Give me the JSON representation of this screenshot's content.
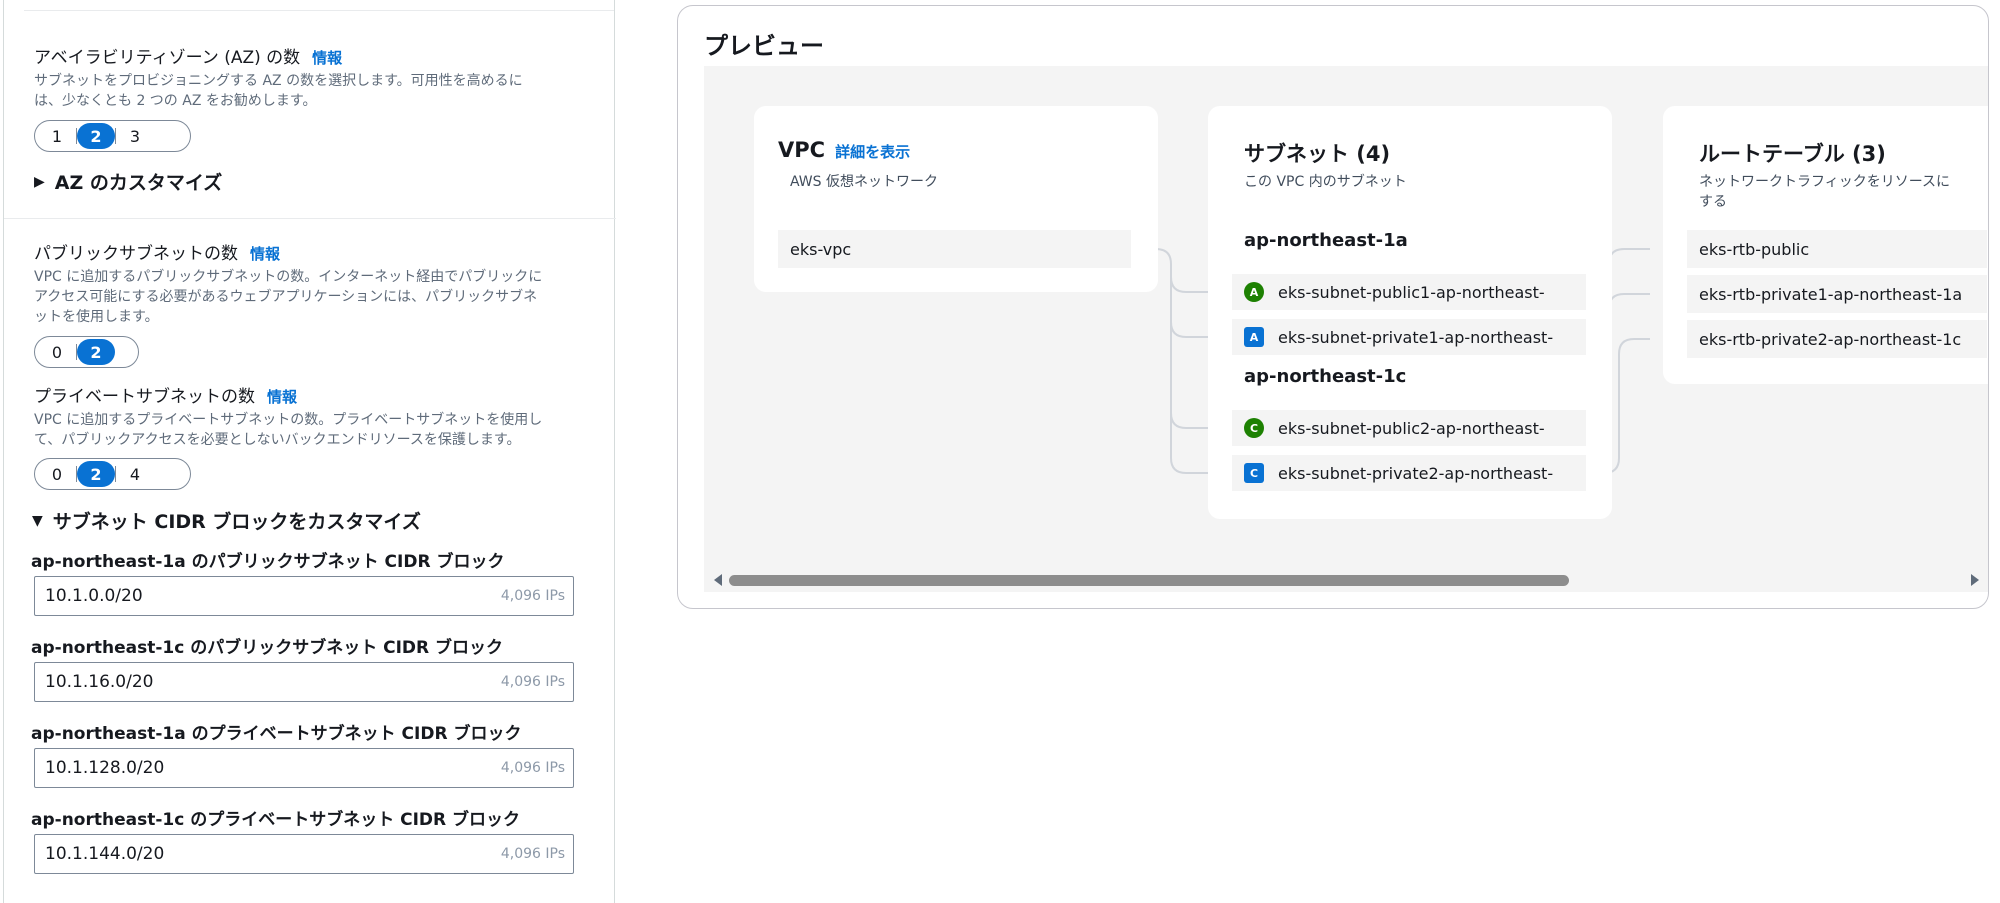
{
  "az_count": {
    "label": "アベイラビリティゾーン (AZ) の数",
    "info": "情報",
    "desc_line1": "サブネットをプロビジョニングする AZ の数を選択します。可用性を高めるに",
    "desc_line2": "は、少なくとも 2 つの AZ をお勧めします。",
    "options": [
      "1",
      "2",
      "3"
    ],
    "selected": "2"
  },
  "az_customize": {
    "label": "AZ のカスタマイズ",
    "caret": "▶"
  },
  "public_subnets": {
    "label": "パブリックサブネットの数",
    "info": "情報",
    "desc_line1": "VPC に追加するパブリックサブネットの数。インターネット経由でパブリックに",
    "desc_line2": "アクセス可能にする必要があるウェブアプリケーションには、パブリックサブネ",
    "desc_line3": "ットを使用します。",
    "options": [
      "0",
      "2"
    ],
    "selected": "2"
  },
  "private_subnets": {
    "label": "プライベートサブネットの数",
    "info": "情報",
    "desc_line1": "VPC に追加するプライベートサブネットの数。プライベートサブネットを使用し",
    "desc_line2": "て、パブリックアクセスを必要としないバックエンドリソースを保護します。",
    "options": [
      "0",
      "2",
      "4"
    ],
    "selected": "2"
  },
  "cidr_customize": {
    "label": "サブネット CIDR ブロックをカスタマイズ",
    "caret": "▼",
    "blocks": [
      {
        "label": "ap-northeast-1a のパブリックサブネット CIDR ブロック",
        "value": "10.1.0.0/20",
        "ips": "4,096 IPs"
      },
      {
        "label": "ap-northeast-1c のパブリックサブネット CIDR ブロック",
        "value": "10.1.16.0/20",
        "ips": "4,096 IPs"
      },
      {
        "label": "ap-northeast-1a のプライベートサブネット CIDR ブロック",
        "value": "10.1.128.0/20",
        "ips": "4,096 IPs"
      },
      {
        "label": "ap-northeast-1c のプライベートサブネット CIDR ブロック",
        "value": "10.1.144.0/20",
        "ips": "4,096 IPs"
      }
    ]
  },
  "preview": {
    "title": "プレビュー",
    "vpc": {
      "title": "VPC",
      "details_link": "詳細を表示",
      "subtitle": "AWS 仮想ネットワーク",
      "item": "eks-vpc"
    },
    "subnets": {
      "title": "サブネット (4)",
      "subtitle": "この VPC 内のサブネット",
      "zones": [
        {
          "name": "ap-northeast-1a",
          "items": [
            {
              "badge": "A",
              "type": "public",
              "label": "eks-subnet-public1-ap-northeast-"
            },
            {
              "badge": "A",
              "type": "private",
              "label": "eks-subnet-private1-ap-northeast-"
            }
          ]
        },
        {
          "name": "ap-northeast-1c",
          "items": [
            {
              "badge": "C",
              "type": "public",
              "label": "eks-subnet-public2-ap-northeast-"
            },
            {
              "badge": "C",
              "type": "private",
              "label": "eks-subnet-private2-ap-northeast-"
            }
          ]
        }
      ]
    },
    "route_tables": {
      "title": "ルートテーブル (3)",
      "subtitle_line1": "ネットワークトラフィックをリソースに",
      "subtitle_line2": "する",
      "items": [
        "eks-rtb-public",
        "eks-rtb-private1-ap-northeast-1a",
        "eks-rtb-private2-ap-northeast-1c"
      ]
    }
  },
  "colors": {
    "accent": "#0972d3",
    "public_badge": "#1d8102",
    "private_badge": "#0972d3",
    "canvas_bg": "#f4f4f4"
  }
}
